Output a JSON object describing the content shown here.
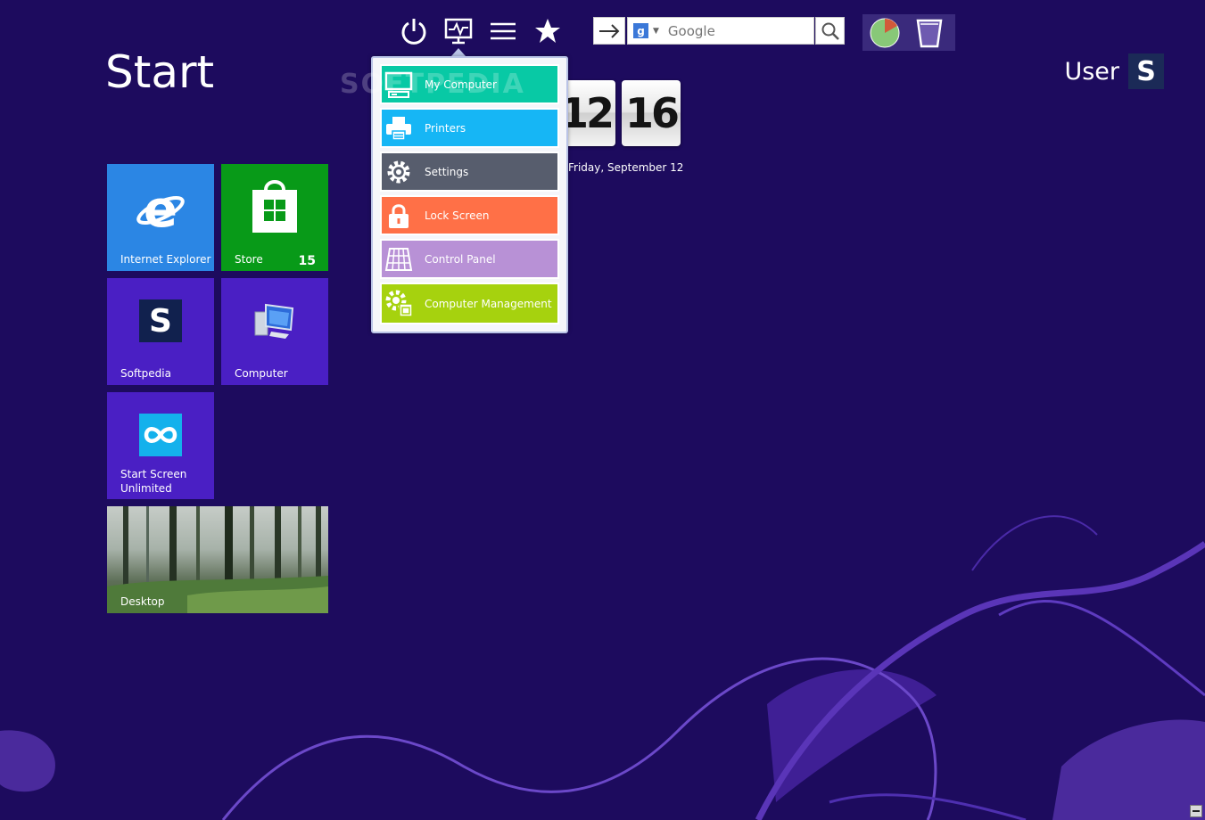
{
  "start": {
    "title": "Start"
  },
  "user": {
    "name": "User",
    "avatar_letter": "S"
  },
  "toolbar": {
    "icons": [
      "power-icon",
      "monitor-pulse-icon",
      "menu-icon",
      "star-icon"
    ],
    "search": {
      "engine_letter": "g",
      "placeholder": "Google",
      "value": ""
    }
  },
  "tiles": [
    {
      "id": "internet-explorer",
      "label": "Internet Explorer",
      "color": "#2b86e4"
    },
    {
      "id": "store",
      "label": "Store",
      "badge": "15",
      "color": "#089a18"
    },
    {
      "id": "softpedia",
      "label": "Softpedia",
      "logo_letter": "S",
      "color": "#4a1fc4"
    },
    {
      "id": "computer",
      "label": "Computer",
      "color": "#4a1fc4"
    },
    {
      "id": "start-screen-unlimited",
      "label_line1": "Start Screen",
      "label_line2": "Unlimited",
      "color": "#4a1fc4"
    },
    {
      "id": "desktop",
      "label": "Desktop"
    }
  ],
  "clock": {
    "hour": "12",
    "minute": "16",
    "date": "Friday, September 12"
  },
  "menu": {
    "items": [
      {
        "label": "My Computer",
        "icon": "monitor-icon",
        "color": "#08c9a5"
      },
      {
        "label": "Printers",
        "icon": "printer-icon",
        "color": "#16b6f5"
      },
      {
        "label": "Settings",
        "icon": "gear-icon",
        "color": "#575d6d"
      },
      {
        "label": "Lock Screen",
        "icon": "lock-icon",
        "color": "#ff7047"
      },
      {
        "label": "Control Panel",
        "icon": "control-panel-icon",
        "color": "#b891d6"
      },
      {
        "label": "Computer Management",
        "icon": "gear-window-icon",
        "color": "#a6d20e"
      }
    ]
  },
  "watermark": "SOFTPEDIA"
}
